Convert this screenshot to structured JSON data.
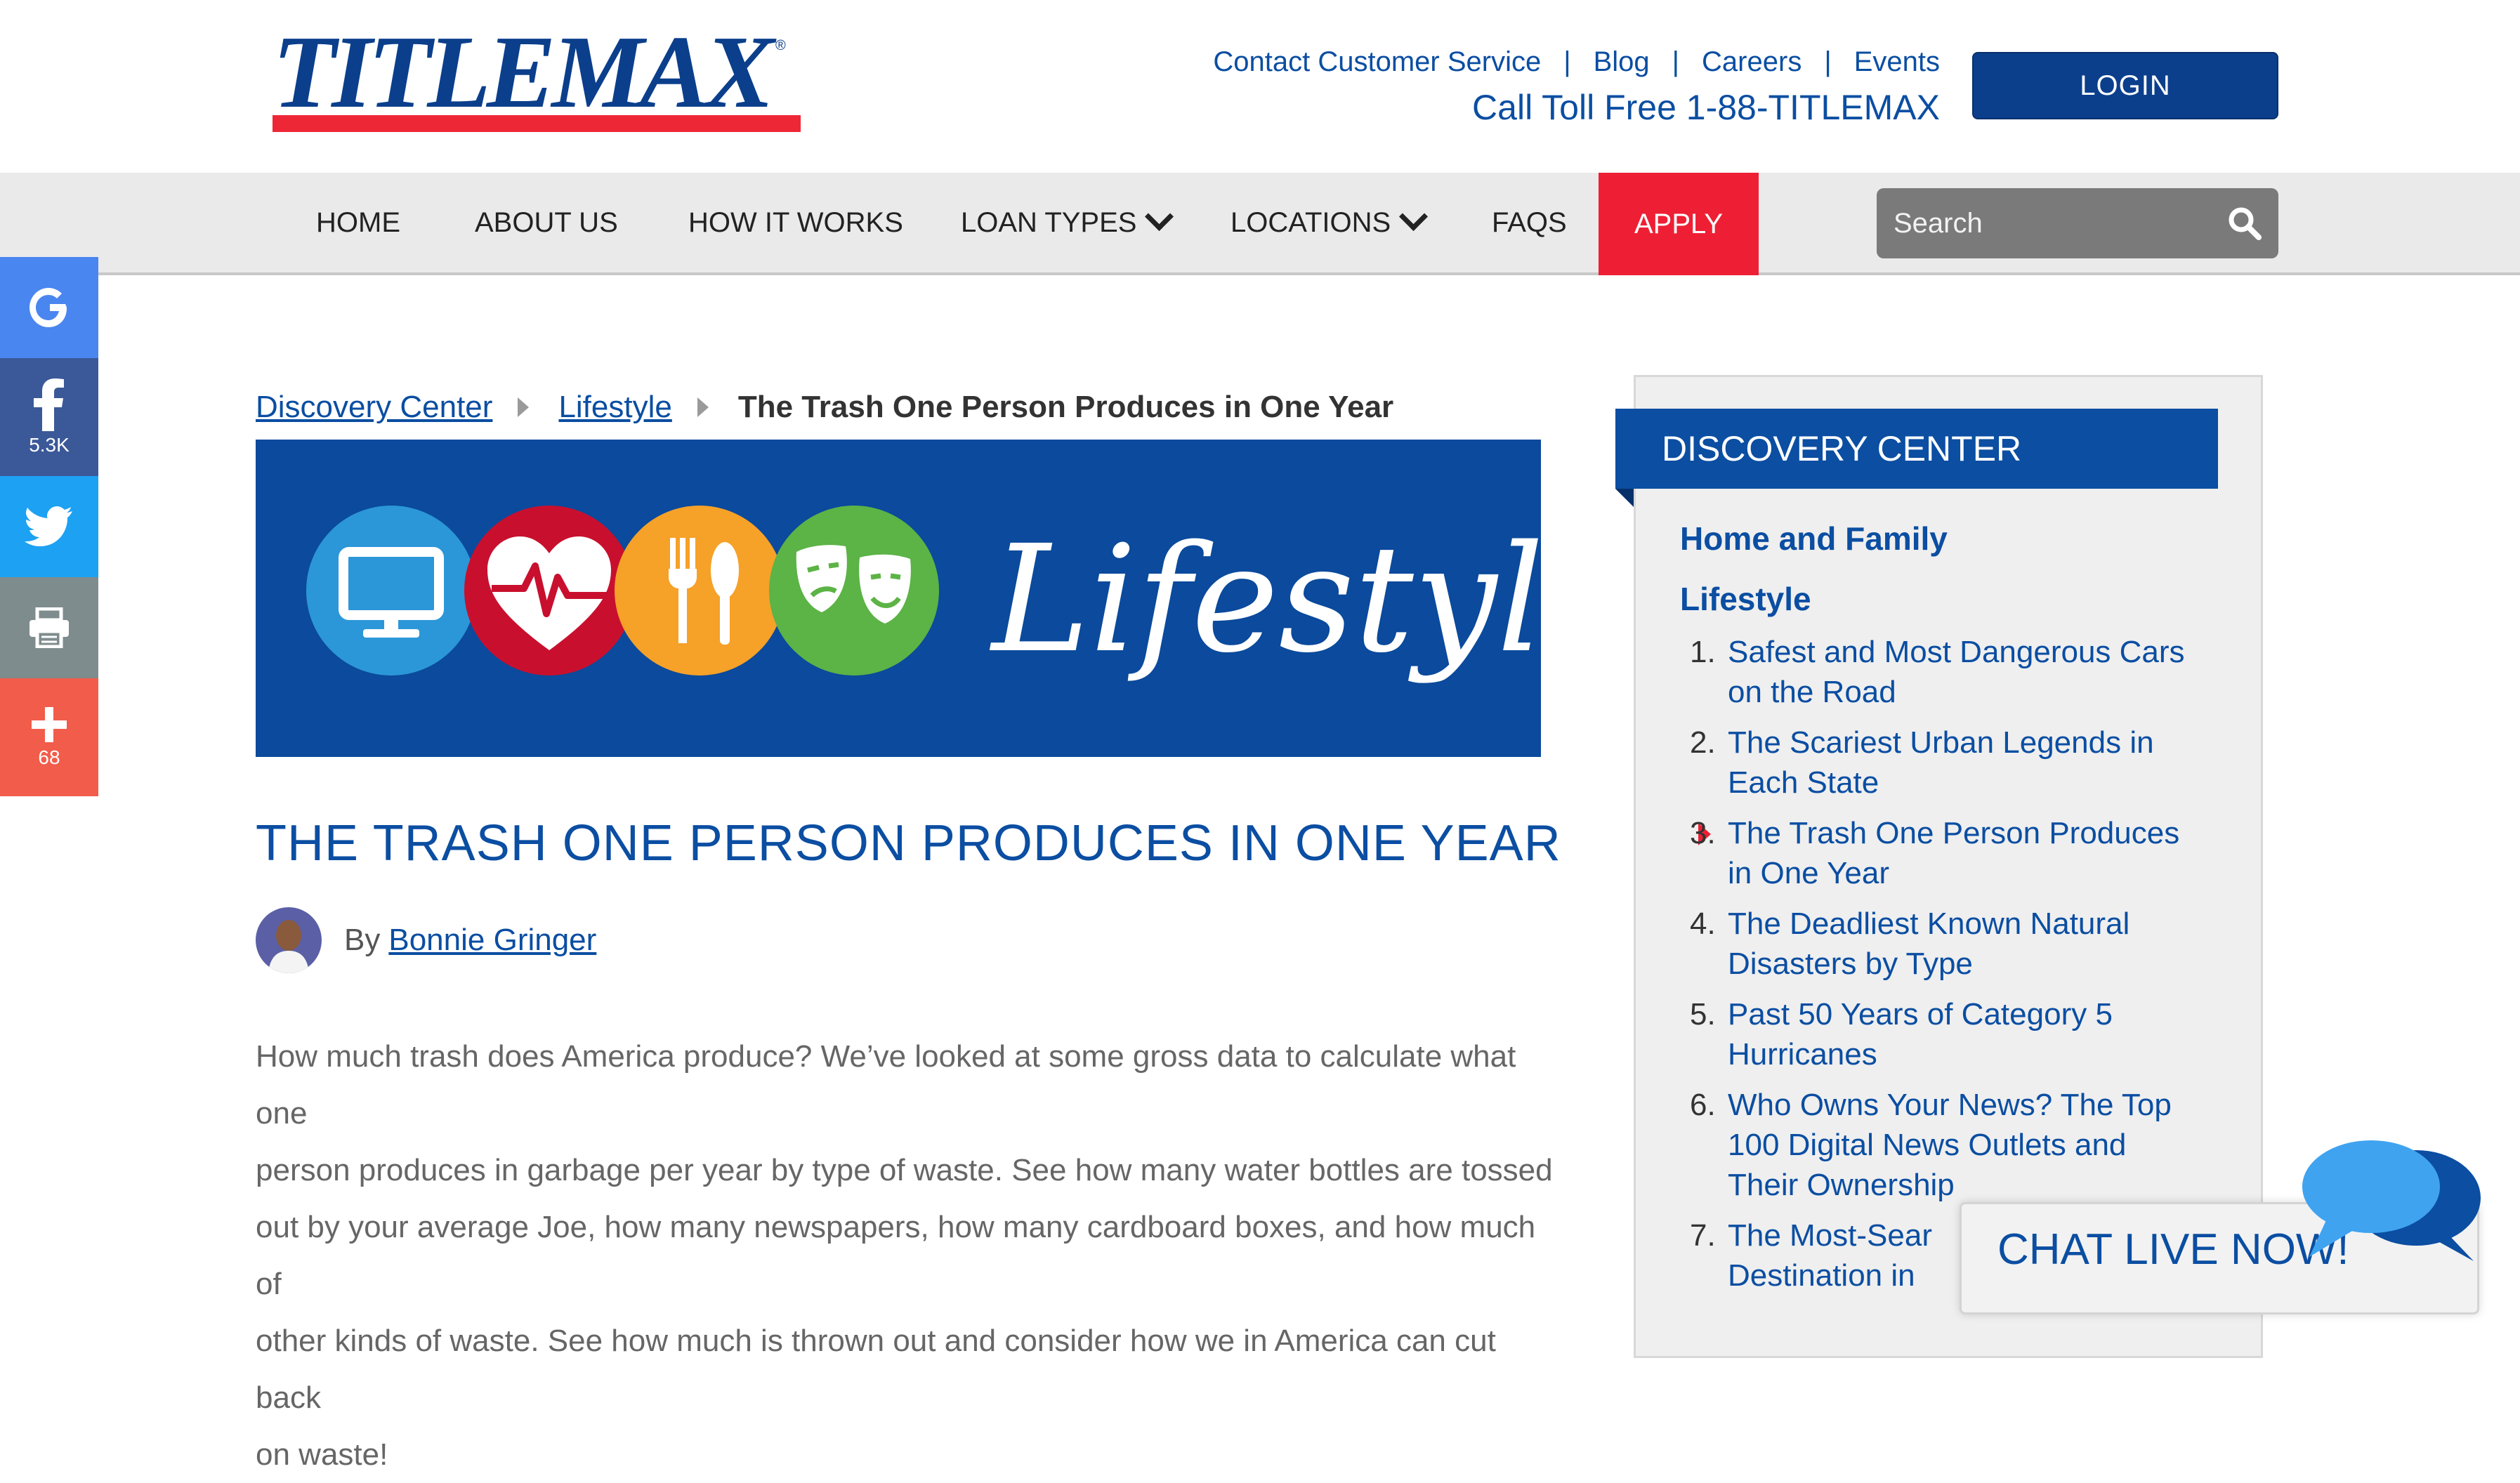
{
  "brand": {
    "logo_text": "TITLEMAX",
    "registered_mark": "®"
  },
  "header": {
    "links": [
      "Contact Customer Service",
      "Blog",
      "Careers",
      "Events"
    ],
    "separator": "|",
    "toll_free": "Call Toll Free 1-88-TITLEMAX",
    "login_label": "LOGIN"
  },
  "nav": {
    "home": "HOME",
    "about": "ABOUT US",
    "how": "HOW IT WORKS",
    "loan_types": "LOAN TYPES",
    "locations": "LOCATIONS",
    "faqs": "FAQS",
    "apply": "APPLY",
    "search_placeholder": "Search"
  },
  "social": {
    "facebook_count": "5.3K",
    "more_count": "68"
  },
  "breadcrumb": {
    "level1": "Discovery Center",
    "level2": "Lifestyle",
    "current": "The Trash One Person Produces in One Year"
  },
  "banner": {
    "text": "Lifestyle"
  },
  "article": {
    "title": "THE TRASH ONE PERSON PRODUCES IN ONE YEAR",
    "by": "By",
    "author": "Bonnie Gringer",
    "body_lines": [
      "How much trash does America produce? We’ve looked at some gross data to calculate what one",
      "person produces in garbage per year by type of waste. See how many water bottles are tossed",
      "out by your average Joe, how many newspapers, how many cardboard boxes, and how much of",
      "other kinds of waste. See how much is thrown out and consider how we in America can cut back",
      "on waste!"
    ]
  },
  "sidebar": {
    "title": "DISCOVERY CENTER",
    "category1": "Home and Family",
    "category2": "Lifestyle",
    "items": [
      {
        "num": "1.",
        "line1": "Safest and Most Dangerous Cars",
        "line2": "on the Road"
      },
      {
        "num": "2.",
        "line1": "The Scariest Urban Legends in",
        "line2": "Each State"
      },
      {
        "num": "3.",
        "line1": "The Trash One Person Produces",
        "line2": "in One Year"
      },
      {
        "num": "4.",
        "line1": "The Deadliest Known Natural",
        "line2": "Disasters by Type"
      },
      {
        "num": "5.",
        "line1": "Past 50 Years of Category 5",
        "line2": "Hurricanes"
      },
      {
        "num": "6.",
        "line1": "Who Owns Your News? The Top",
        "line2": "100 Digital News Outlets and",
        "line3": "Their Ownership"
      },
      {
        "num": "7.",
        "line1": "The Most-Sear",
        "line2": "Destination in"
      }
    ]
  },
  "chat": {
    "label": "CHAT LIVE NOW!"
  },
  "colors": {
    "brand_blue": "#0b4ea2",
    "dark_blue": "#0b3f8c",
    "apply_red": "#ee1f34",
    "google": "#4a86f0",
    "facebook": "#3b5998",
    "twitter": "#1da1f2",
    "print": "#7f8c8d",
    "share_more": "#f25c4a"
  }
}
